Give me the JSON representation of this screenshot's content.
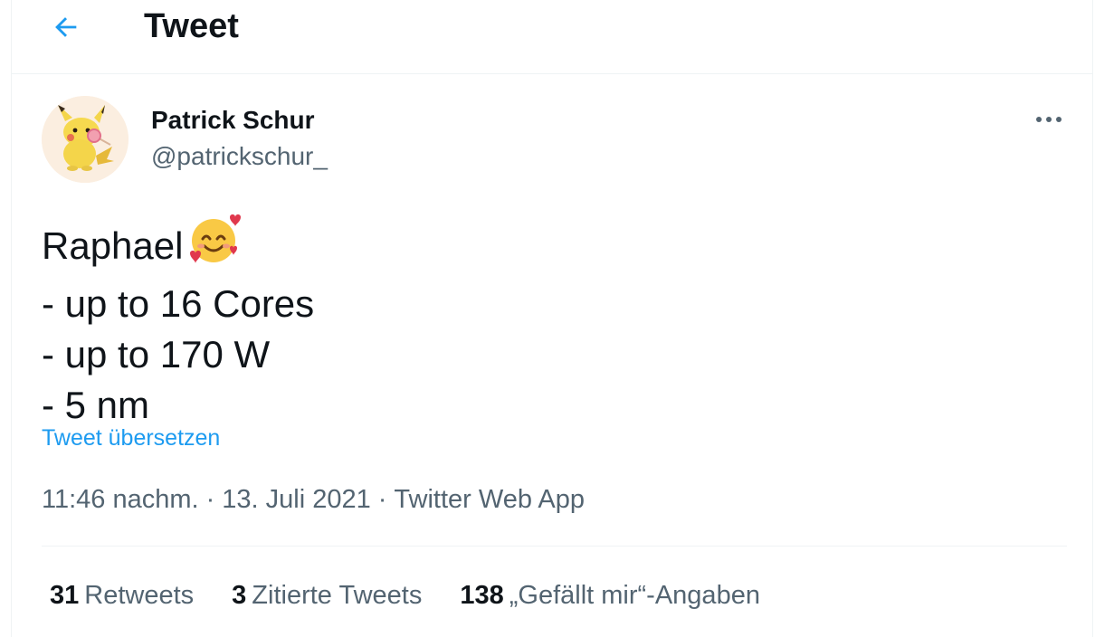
{
  "header": {
    "back_icon": "arrow-left-icon",
    "title": "Tweet"
  },
  "colors": {
    "accent": "#1d9bf0",
    "text_primary": "#0f1419",
    "text_secondary": "#536471",
    "divider": "#eff3f4"
  },
  "tweet": {
    "author": {
      "display_name": "Patrick Schur",
      "handle": "@patrickschur_",
      "avatar_icon": "pikachu-avatar"
    },
    "more_icon": "more-horizontal-icon",
    "lines": [
      "Raphael",
      "- up to 16 Cores",
      "- up to 170 W",
      "- 5 nm"
    ],
    "emoji_icon": "smiling-face-with-hearts-emoji",
    "translate_label": "Tweet übersetzen",
    "time": "11:46 nachm.",
    "separator": "·",
    "date": "13. Juli 2021",
    "source": "Twitter Web App",
    "stats": [
      {
        "count": "31",
        "label": "Retweets"
      },
      {
        "count": "3",
        "label": "Zitierte Tweets"
      },
      {
        "count": "138",
        "label": "„Gefällt mir“-Angaben"
      }
    ]
  }
}
